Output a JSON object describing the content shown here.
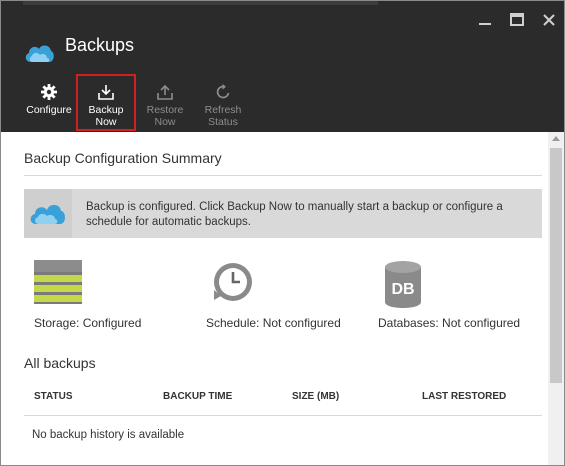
{
  "window": {
    "title": "Backups",
    "controls": [
      "minimize-icon",
      "maximize-icon",
      "close-icon"
    ]
  },
  "toolbar": {
    "configure": {
      "label": "Configure",
      "icon": "gear-icon",
      "enabled": true
    },
    "backup_now": {
      "label_line1": "Backup",
      "label_line2": "Now",
      "icon": "download-icon",
      "enabled": true,
      "highlighted": true
    },
    "restore_now": {
      "label_line1": "Restore",
      "label_line2": "Now",
      "icon": "upload-icon",
      "enabled": false
    },
    "refresh_status": {
      "label_line1": "Refresh",
      "label_line2": "Status",
      "icon": "refresh-icon",
      "enabled": false
    }
  },
  "summary": {
    "title": "Backup Configuration Summary",
    "banner_text": "Backup is configured. Click Backup Now to manually start a backup or configure a schedule for automatic backups.",
    "banner_icon": "cloud-icon",
    "storage": {
      "label": "Storage: Configured",
      "icon": "storage-icon"
    },
    "schedule": {
      "label": "Schedule: Not configured",
      "icon": "clock-icon"
    },
    "databases": {
      "label": "Databases: Not configured",
      "icon": "database-icon",
      "icon_text": "DB"
    }
  },
  "backups": {
    "title": "All backups",
    "columns": [
      "STATUS",
      "BACKUP TIME",
      "SIZE (MB)",
      "LAST RESTORED"
    ],
    "empty_message": "No backup history is available"
  },
  "colors": {
    "header_bg": "#2b2b2b",
    "highlight_border": "#d21f1f",
    "banner_bg": "#d9d9d9",
    "storage_green": "#c6d84a",
    "cloud_blue": "#3aa0d8"
  }
}
